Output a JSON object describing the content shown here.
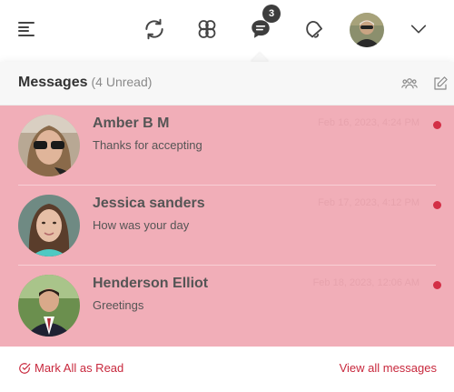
{
  "topbar": {
    "notification_badge": "3",
    "icons": [
      "menu-icon",
      "refresh-icon",
      "groups-icon",
      "chat-icon",
      "bell-icon",
      "chevron-down-icon"
    ]
  },
  "panel": {
    "title": "Messages",
    "unread_count": "(4 Unread)"
  },
  "messages": [
    {
      "name": "Amber B M",
      "text": "Thanks for accepting",
      "time": "Feb 16, 2023, 4:24 PM"
    },
    {
      "name": "Jessica sanders",
      "text": "How was your day",
      "time": "Feb 17, 2023, 4:12 PM"
    },
    {
      "name": "Henderson Elliot",
      "text": "Greetings",
      "time": "Feb 18, 2023, 12:06 AM"
    }
  ],
  "footer": {
    "mark_all_read": "Mark All as Read",
    "view_all": "View all messages"
  },
  "colors": {
    "accent": "#c8283d",
    "unread_bg": "#f1aeb8",
    "unread_dot": "#d32f46"
  }
}
